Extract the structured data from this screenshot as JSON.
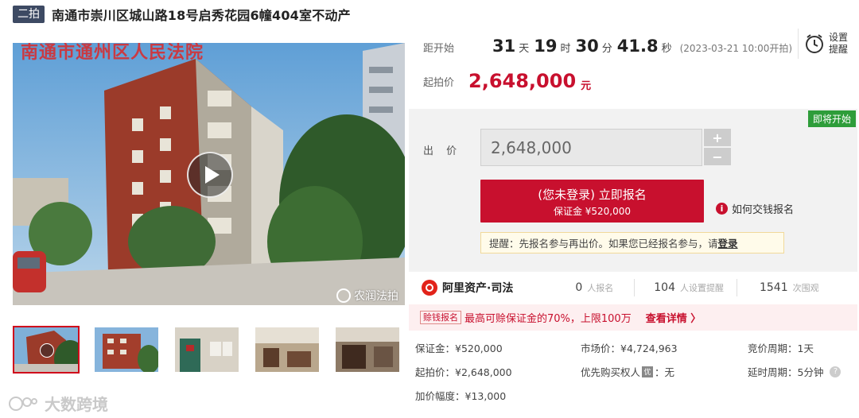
{
  "header": {
    "tag": "二拍",
    "title": "南通市崇川区城山路18号启秀花园6幢404室不动产"
  },
  "gallery": {
    "overlay_text": "南通市通州区人民法院",
    "watermark": "农润法拍",
    "thumbnail_count": 5
  },
  "countdown": {
    "label": "距开始",
    "days": "31",
    "days_unit": "天",
    "hours": "19",
    "hours_unit": "时",
    "minutes": "30",
    "minutes_unit": "分",
    "seconds": "41.8",
    "seconds_unit": "秒",
    "start_time": "(2023-03-21 10:00开拍)"
  },
  "remind": {
    "line1": "设置",
    "line2": "提醒"
  },
  "start_price": {
    "label": "起拍价",
    "value": "2,648,000",
    "unit": "元"
  },
  "bid": {
    "status_badge": "即将开始",
    "label": "出 价",
    "input_value": "2,648,000",
    "plus": "+",
    "minus": "−",
    "register_main": "(您未登录) 立即报名",
    "register_sub": "保证金 ¥520,000",
    "offline_link": "如何交钱报名",
    "notice_prefix": "提醒：先报名参与再出价。如果您已经报名参与，请",
    "notice_login": "登录"
  },
  "stats": {
    "brand": "阿里资产·司法",
    "applicants_num": "0",
    "applicants_label": "人报名",
    "reminders_num": "104",
    "reminders_label": "人设置提醒",
    "views_num": "1541",
    "views_label": "次围观"
  },
  "loan": {
    "tag": "赊钱报名",
    "text": "最高可赊保证金的70%，上限100万",
    "link": "查看详情 〉"
  },
  "details": {
    "deposit": "保证金：¥520,000",
    "market_price": "市场价：¥4,724,963",
    "bid_period": "竞价周期：1天",
    "start_price": "起拍价：¥2,648,000",
    "priority_prefix": "优先购买权人",
    "priority_badge": "优",
    "priority_value": "：无",
    "delay_period": "延时周期：5分钟",
    "increment": "加价幅度：¥13,000"
  },
  "brand_watermark": "大数跨境",
  "colors": {
    "accent_red": "#c8102e",
    "badge_green": "#2e9d3a",
    "tag_navy": "#3d4a63"
  }
}
